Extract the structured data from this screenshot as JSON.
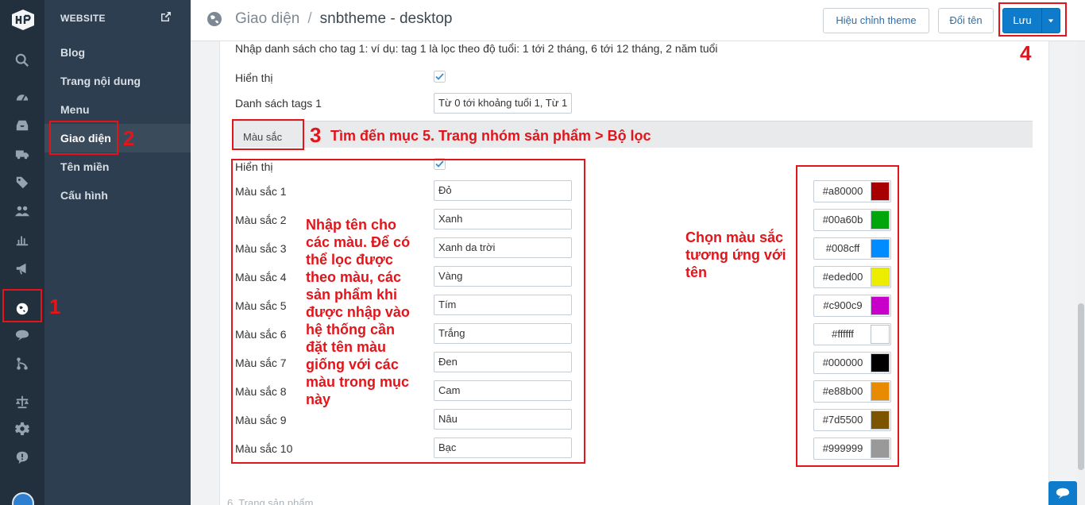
{
  "sidebar": {
    "header": "WEBSITE",
    "items": [
      {
        "label": "Blog"
      },
      {
        "label": "Trang nội dung"
      },
      {
        "label": "Menu"
      },
      {
        "label": "Giao diện"
      },
      {
        "label": "Tên miền"
      },
      {
        "label": "Cấu hình"
      }
    ]
  },
  "header": {
    "breadcrumb_root": "Giao diện",
    "breadcrumb_sep": "/",
    "breadcrumb_current": "snbtheme - desktop",
    "edit_theme_label": "Hiệu chỉnh theme",
    "rename_label": "Đổi tên",
    "save_label": "Lưu"
  },
  "content": {
    "intro": "Nhập danh sách cho tag 1: ví dụ: tag 1 là lọc theo độ tuổi: 1 tới 2 tháng, 6 tới 12 tháng, 2 năm tuổi",
    "show_label": "Hiển thị",
    "tags_label": "Danh sách tags 1",
    "tags_value": "Từ 0 tới khoảng tuổi 1, Từ 1",
    "section_title": "Màu sắc",
    "show_label_2": "Hiển thị",
    "colors": [
      {
        "label": "Màu sắc 1",
        "name": "Đỏ",
        "code": "#a80000",
        "hex": "#a80000"
      },
      {
        "label": "Màu sắc 2",
        "name": "Xanh",
        "code": "#00a60b",
        "hex": "#00a60b"
      },
      {
        "label": "Màu sắc 3",
        "name": "Xanh da trời",
        "code": "#008cff",
        "hex": "#008cff"
      },
      {
        "label": "Màu sắc 4",
        "name": "Vàng",
        "code": "#eded00",
        "hex": "#eded00"
      },
      {
        "label": "Màu sắc 5",
        "name": "Tím",
        "code": "#c900c9",
        "hex": "#c900c9"
      },
      {
        "label": "Màu sắc 6",
        "name": "Trắng",
        "code": "#ffffff",
        "hex": "#ffffff"
      },
      {
        "label": "Màu sắc 7",
        "name": "Đen",
        "code": "#000000",
        "hex": "#000000"
      },
      {
        "label": "Màu sắc 8",
        "name": "Cam",
        "code": "#e88b00",
        "hex": "#e88b00"
      },
      {
        "label": "Màu sắc 9",
        "name": "Nâu",
        "code": "#7d5500",
        "hex": "#7d5500"
      },
      {
        "label": "Màu sắc 10",
        "name": "Bạc",
        "code": "#999999",
        "hex": "#999999"
      }
    ],
    "next_section": "6. Trang sản phẩm"
  },
  "annotations": {
    "n1": "1",
    "n2": "2",
    "n3": "3",
    "n4": "4",
    "step3_text": "Tìm đến mục 5. Trang nhóm sản phẩm > Bộ lọc",
    "names_note": "Nhập tên cho các màu. Để có thể lọc được theo màu, các sản phẩm khi được nhập vào hệ thống cần đặt tên màu giống với các màu trong mục này",
    "colors_note": "Chọn màu sắc tương ứng với tên"
  },
  "theme": {
    "accent": "#0e7bcb",
    "annotation_red": "#e3151b",
    "rail_bg": "#22303e",
    "menu_bg": "#2d3e50"
  },
  "icons": [
    "logo-icon",
    "search-icon",
    "dashboard-icon",
    "inbox-icon",
    "truck-icon",
    "tag-icon",
    "users-icon",
    "chart-icon",
    "megaphone-icon",
    "globe-icon",
    "chat-icon",
    "branch-icon",
    "scale-icon",
    "gear-icon",
    "alert-icon",
    "external-link-icon",
    "checkbox-icon"
  ]
}
